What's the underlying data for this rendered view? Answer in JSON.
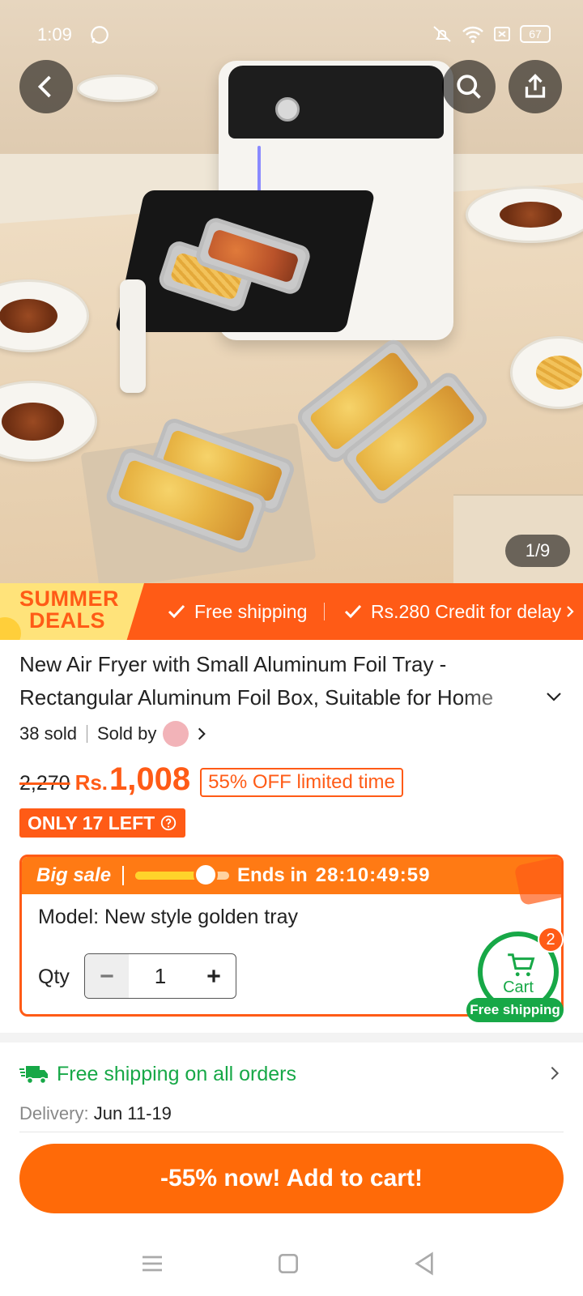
{
  "status_bar": {
    "time": "1:09",
    "battery": "67"
  },
  "gallery": {
    "counter": "1/9"
  },
  "promo": {
    "badge_line1": "SUMMER",
    "badge_line2": "DEALS",
    "benefit_1": "Free shipping",
    "benefit_2": "Rs.280 Credit for delay"
  },
  "product": {
    "title_line1": "New Air Fryer with Small Aluminum Foil Tray -",
    "title_line2": "Rectangular Aluminum Foil Box, Suitable for Home",
    "sold": "38 sold",
    "sold_by": "Sold by"
  },
  "pricing": {
    "original": "2,270",
    "currency": "Rs.",
    "current": "1,008",
    "discount_badge": "55% OFF limited time",
    "stock": "ONLY 17 LEFT"
  },
  "sale": {
    "label": "Big sale",
    "ends_label": "Ends in",
    "countdown": "28:10:49:59",
    "progress": 0.75,
    "model": "Model: New style golden tray",
    "qty_label": "Qty",
    "qty_value": "1"
  },
  "cart": {
    "label": "Cart",
    "count": "2",
    "free_shipping": "Free shipping"
  },
  "shipping": {
    "headline": "Free shipping on all orders",
    "delivery_label": "Delivery:",
    "delivery_dates": "Jun 11-19"
  },
  "cta": {
    "label": "-55% now! Add to cart!"
  },
  "colors": {
    "accent": "#ff5b16",
    "green": "#17a847",
    "cta": "#ff6a08"
  }
}
